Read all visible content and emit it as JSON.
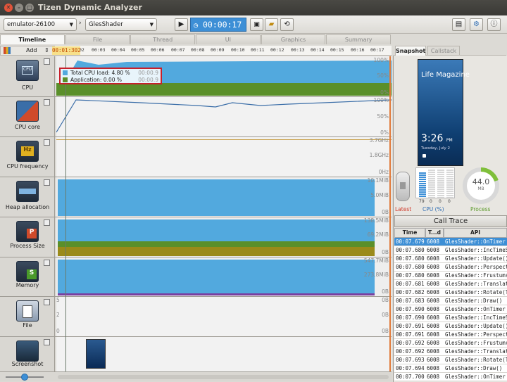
{
  "window": {
    "title": "Tizen Dynamic Analyzer"
  },
  "toolbar": {
    "device": "emulator-26100",
    "app": "GlesShader",
    "timer": "00:00:17"
  },
  "tabs": [
    "Timeline",
    "File",
    "Thread",
    "UI",
    "Graphics",
    "Summary"
  ],
  "timeline": {
    "add_label": "Add",
    "cursor_time": "00:01:302",
    "ticks": [
      "02",
      "00:03",
      "00:04",
      "00:05",
      "00:06",
      "00:07",
      "00:08",
      "00:09",
      "00:10",
      "00:11",
      "00:12",
      "00:13",
      "00:14",
      "00:15",
      "00:16",
      "00:17"
    ]
  },
  "lanes": [
    {
      "name": "CPU",
      "axis": [
        "100%",
        "50%",
        "0%"
      ]
    },
    {
      "name": "CPU core",
      "axis": [
        "100%",
        "50%",
        "0%"
      ]
    },
    {
      "name": "CPU frequency",
      "axis": [
        "3.7GHz",
        "1.8GHz",
        "0Hz"
      ]
    },
    {
      "name": "Heap allocation",
      "axis": [
        "10.1MiB",
        "5.0MiB",
        "0B"
      ]
    },
    {
      "name": "Process Size",
      "axis": [
        "138.5MiB",
        "69.2MiB",
        "0B"
      ]
    },
    {
      "name": "Memory",
      "axis": [
        "547.7MiB",
        "273.8MiB",
        "0B"
      ]
    },
    {
      "name": "File",
      "axis": [
        "0B",
        "0B",
        "0B"
      ],
      "left_axis": [
        "5",
        "2",
        "0"
      ]
    },
    {
      "name": "Screenshot",
      "axis": []
    }
  ],
  "tooltip": {
    "rows": [
      {
        "label": "Total CPU load: 4.80 %",
        "time": "00:00.9",
        "color": "#52a9de"
      },
      {
        "label": "Application: 0.00 %",
        "time": "00:00.9",
        "color": "#5a8f2a"
      }
    ]
  },
  "right_panel": {
    "tabs": [
      "Snapshot",
      "Callstack"
    ],
    "phone": {
      "app_title": "Life Magazine",
      "time": "3:26",
      "ampm": "PM",
      "date": "Tuesday, July 2"
    },
    "cpu_bars": [
      "79",
      "0",
      "0",
      "0"
    ],
    "process_value": "44.0",
    "process_unit": "MB",
    "labels": {
      "latest": "Latest",
      "cpu": "CPU (%)",
      "process": "Process"
    }
  },
  "call_trace": {
    "title": "Call Trace",
    "columns": [
      "Time",
      "T...d",
      "API"
    ],
    "rows": [
      [
        "00:07.679",
        "6008",
        "GlesShader::OnTimer"
      ],
      [
        "00:07.680",
        "6008",
        "GlesShader::IncTimeS"
      ],
      [
        "00:07.680",
        "6008",
        "GlesShader::Update()"
      ],
      [
        "00:07.680",
        "6008",
        "GlesShader::Perspect"
      ],
      [
        "00:07.680",
        "6008",
        "GlesShader::Frustum("
      ],
      [
        "00:07.681",
        "6008",
        "GlesShader::Translate"
      ],
      [
        "00:07.682",
        "6008",
        "GlesShader::Rotate(T"
      ],
      [
        "00:07.683",
        "6008",
        "GlesShader::Draw()"
      ],
      [
        "00:07.690",
        "6008",
        "GlesShader::OnTimer"
      ],
      [
        "00:07.690",
        "6008",
        "GlesShader::IncTimeS"
      ],
      [
        "00:07.691",
        "6008",
        "GlesShader::Update()"
      ],
      [
        "00:07.691",
        "6008",
        "GlesShader::Perspect"
      ],
      [
        "00:07.692",
        "6008",
        "GlesShader::Frustum("
      ],
      [
        "00:07.692",
        "6008",
        "GlesShader::Translate"
      ],
      [
        "00:07.693",
        "6008",
        "GlesShader::Rotate(T"
      ],
      [
        "00:07.694",
        "6008",
        "GlesShader::Draw()"
      ],
      [
        "00:07.700",
        "6008",
        "GlesShader::OnTimer"
      ]
    ]
  },
  "colors": {
    "accent": "#3d8fd6",
    "cpu_area": "#52a9de",
    "app_area": "#5a8f2a",
    "olive": "#9a8a1a",
    "purple": "#7a3fa0",
    "highlight": "#c8202b"
  }
}
